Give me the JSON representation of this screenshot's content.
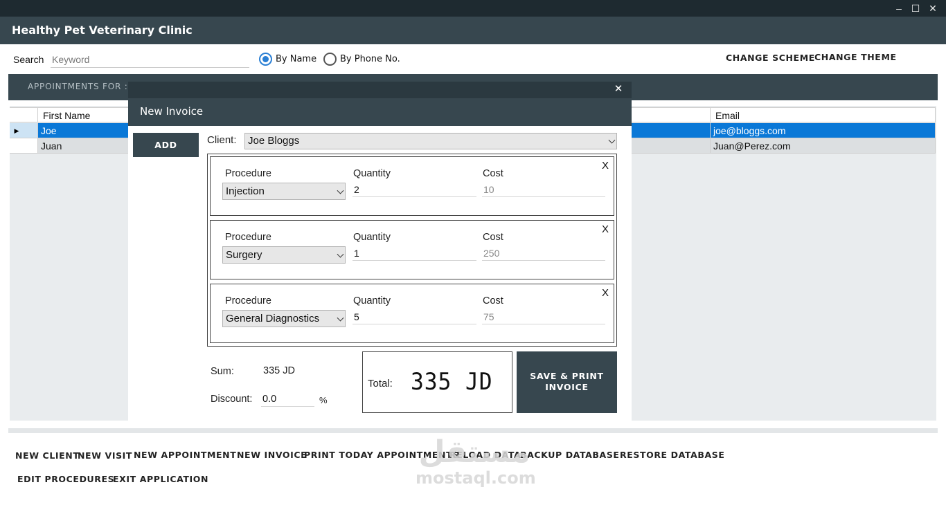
{
  "window": {
    "title": "Healthy Pet Veterinary Clinic",
    "minimize_glyph": "–",
    "maximize_glyph": "☐",
    "close_glyph": "✕"
  },
  "search": {
    "label": "Search",
    "placeholder": "Keyword",
    "options": [
      {
        "label": "By Name",
        "selected": true
      },
      {
        "label": "By Phone No.",
        "selected": false
      }
    ]
  },
  "header_actions": {
    "change_scheme": "CHANGE SCHEME",
    "change_theme": "CHANGE THEME"
  },
  "appointments_bar": {
    "label": "APPOINTMENTS FOR :"
  },
  "clients_grid": {
    "columns": {
      "first_name": "First Name",
      "email": "Email"
    },
    "rows": [
      {
        "first_name": "Joe",
        "email": "joe@bloggs.com",
        "selected": true
      },
      {
        "first_name": "Juan",
        "email": "Juan@Perez.com",
        "selected": false
      }
    ]
  },
  "dialog": {
    "title": "New Invoice",
    "close_glyph": "✕",
    "add_label": "ADD",
    "client_label": "Client:",
    "client_value": "Joe Bloggs",
    "procedure_label": "Procedure",
    "quantity_label": "Quantity",
    "cost_label": "Cost",
    "remove_glyph": "X",
    "items": [
      {
        "procedure": "Injection",
        "quantity": "2",
        "cost": "10"
      },
      {
        "procedure": "Surgery",
        "quantity": "1",
        "cost": "250"
      },
      {
        "procedure": "General Diagnostics",
        "quantity": "5",
        "cost": "75"
      }
    ],
    "sum_label": "Sum:",
    "sum_value": "335 JD",
    "discount_label": "Discount:",
    "discount_value": "0.0",
    "percent": "%",
    "total_label": "Total:",
    "total_value": "335 JD",
    "save_label_line1": "SAVE & PRINT",
    "save_label_line2": "INVOICE"
  },
  "bottom_menu": {
    "new_client": "NEW CLIENT",
    "new_visit": "NEW VISIT",
    "new_appointment": "NEW APPOINTMENT",
    "new_invoice": "NEW INVOICE",
    "print_today": "PRINT TODAY APPOINTMENTS",
    "reload": "RELOAD DATA",
    "backup": "BACKUP DATABASE",
    "restore": "RESTORE DATABASE",
    "edit_procedures": "EDIT PROCEDURES",
    "exit": "EXIT APPLICATION"
  },
  "watermark": {
    "arabic": "مستقل",
    "latin": "mostaql.com"
  },
  "colors": {
    "header": "#37474f",
    "titlebar": "#1e2a30",
    "selection": "#0a78d7",
    "radio_accent": "#2a7fd4"
  }
}
